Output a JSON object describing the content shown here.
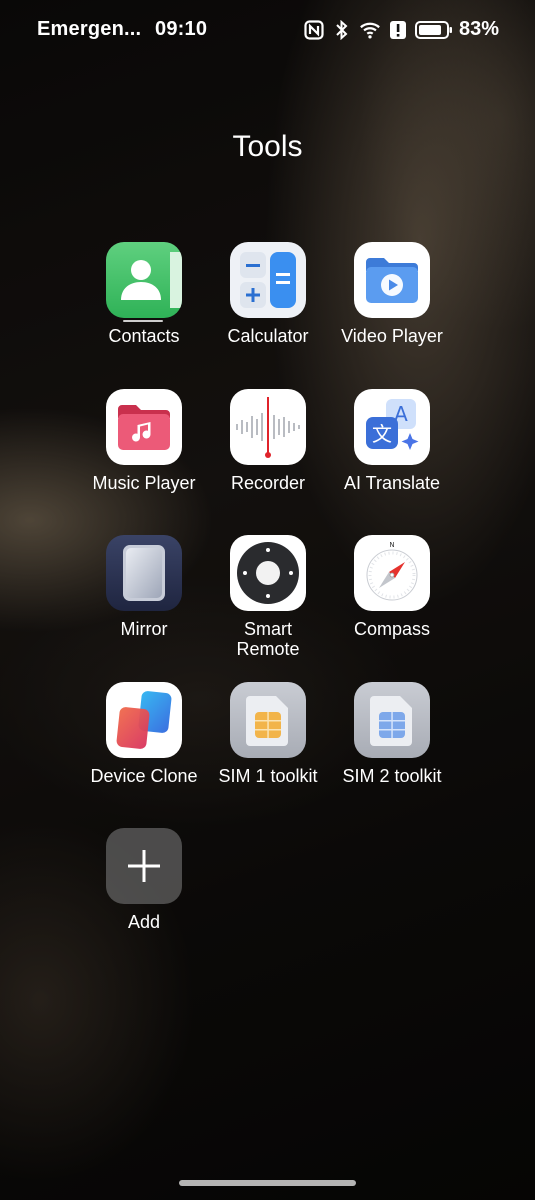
{
  "status_bar": {
    "carrier": "Emergen...",
    "time": "09:10",
    "icons": [
      "nfc-icon",
      "bluetooth-icon",
      "wifi-icon",
      "alert-icon",
      "battery-icon"
    ],
    "battery_percent": "83%"
  },
  "folder": {
    "title": "Tools"
  },
  "apps": [
    {
      "label": "Contacts",
      "icon": "contacts-icon",
      "color": "#3fc46a"
    },
    {
      "label": "Calculator",
      "icon": "calculator-icon",
      "color": "#e8ecf2"
    },
    {
      "label": "Video Player",
      "icon": "video-player-icon",
      "color": "#ffffff"
    },
    {
      "label": "Music Player",
      "icon": "music-player-icon",
      "color": "#ffffff"
    },
    {
      "label": "Recorder",
      "icon": "recorder-icon",
      "color": "#ffffff"
    },
    {
      "label": "AI Translate",
      "icon": "ai-translate-icon",
      "color": "#ffffff"
    },
    {
      "label": "Mirror",
      "icon": "mirror-icon",
      "color": "#2b3350"
    },
    {
      "label": "Smart\nRemote",
      "icon": "smart-remote-icon",
      "color": "#ffffff"
    },
    {
      "label": "Compass",
      "icon": "compass-icon",
      "color": "#ffffff"
    },
    {
      "label": "Device Clone",
      "icon": "device-clone-icon",
      "color": "#ffffff"
    },
    {
      "label": "SIM 1 toolkit",
      "icon": "sim1-toolkit-icon",
      "color": "#b9bcc4"
    },
    {
      "label": "SIM 2 toolkit",
      "icon": "sim2-toolkit-icon",
      "color": "#b9bcc4"
    },
    {
      "label": "Add",
      "icon": "add-icon",
      "color": "#555555"
    }
  ]
}
